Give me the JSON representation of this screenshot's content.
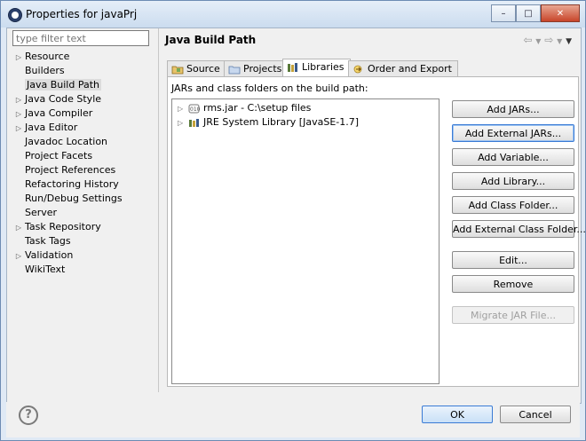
{
  "window": {
    "title": "Properties for javaPrj"
  },
  "filter": {
    "placeholder": "type filter text"
  },
  "sidebar": {
    "items": [
      {
        "label": "Resource",
        "expandable": true
      },
      {
        "label": "Builders",
        "expandable": false
      },
      {
        "label": "Java Build Path",
        "expandable": false,
        "selected": true
      },
      {
        "label": "Java Code Style",
        "expandable": true
      },
      {
        "label": "Java Compiler",
        "expandable": true
      },
      {
        "label": "Java Editor",
        "expandable": true
      },
      {
        "label": "Javadoc Location",
        "expandable": false
      },
      {
        "label": "Project Facets",
        "expandable": false
      },
      {
        "label": "Project References",
        "expandable": false
      },
      {
        "label": "Refactoring History",
        "expandable": false
      },
      {
        "label": "Run/Debug Settings",
        "expandable": false
      },
      {
        "label": "Server",
        "expandable": false
      },
      {
        "label": "Task Repository",
        "expandable": true
      },
      {
        "label": "Task Tags",
        "expandable": false
      },
      {
        "label": "Validation",
        "expandable": true
      },
      {
        "label": "WikiText",
        "expandable": false
      }
    ]
  },
  "page": {
    "title": "Java Build Path"
  },
  "tabs": [
    {
      "label": "Source"
    },
    {
      "label": "Projects"
    },
    {
      "label": "Libraries",
      "active": true
    },
    {
      "label": "Order and Export"
    }
  ],
  "libraries": {
    "header": "JARs and class folders on the build path:",
    "items": [
      {
        "label": "rms.jar - C:\\setup files"
      },
      {
        "label": "JRE System Library [JavaSE-1.7]"
      }
    ]
  },
  "buttons": {
    "add_jars": "Add JARs...",
    "add_external_jars": "Add External JARs...",
    "add_variable": "Add Variable...",
    "add_library": "Add Library...",
    "add_class_folder": "Add Class Folder...",
    "add_external_class_folder": "Add External Class Folder...",
    "edit": "Edit...",
    "remove": "Remove",
    "migrate_jar": "Migrate JAR File..."
  },
  "dialog": {
    "ok": "OK",
    "cancel": "Cancel",
    "help": "?"
  }
}
